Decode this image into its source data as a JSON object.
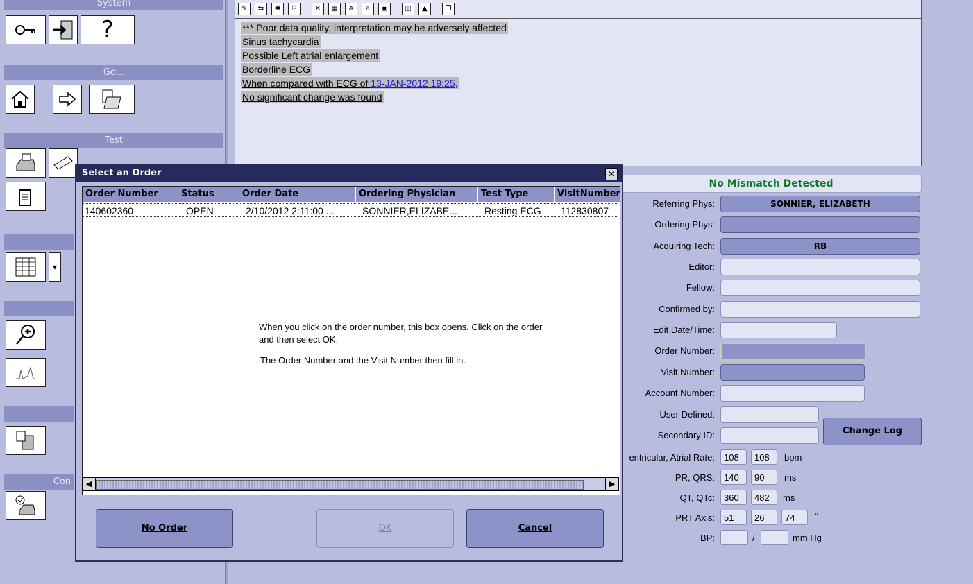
{
  "left": {
    "sections": {
      "system": "System",
      "go": "Go...",
      "test": "Test",
      "con": "Con"
    }
  },
  "ecg": {
    "lines": [
      "*** Poor data quality, interpretation may be adversely affected",
      "Sinus tachycardia",
      "Possible Left atrial enlargement",
      "Borderline ECG"
    ],
    "compare_prefix": "When compared with ECG of ",
    "compare_link": "13-JAN-2012 19:25,",
    "no_change": "No significant change was found"
  },
  "form": {
    "mismatch": "No Mismatch Detected",
    "labels": {
      "referring": "Referring Phys:",
      "ordering": "Ordering Phys:",
      "acquiring": "Acquiring Tech:",
      "editor": "Editor:",
      "fellow": "Fellow:",
      "confirmed": "Confirmed by:",
      "edit_date": "Edit Date/Time:",
      "order_number": "Order Number:",
      "visit_number": "Visit Number:",
      "account_number": "Account Number:",
      "user_defined": "User Defined:",
      "secondary_id": "Secondary ID:",
      "rate": "entricular, Atrial Rate:",
      "pr_qrs": "PR, QRS:",
      "qt_qtc": "QT, QTc:",
      "prt_axis": "PRT Axis:",
      "bp": "BP:"
    },
    "values": {
      "referring": "SONNIER, ELIZABETH",
      "acquiring": "RB",
      "vent_rate": "108",
      "atrial_rate": "108",
      "pr": "140",
      "qrs": "90",
      "qt": "360",
      "qtc": "482",
      "p_axis": "51",
      "r_axis": "26",
      "t_axis": "74"
    },
    "units": {
      "bpm": "bpm",
      "ms1": "ms",
      "ms2": "ms",
      "deg": "°",
      "slash": "/",
      "mmhg": "mm Hg"
    },
    "change_log": "Change Log"
  },
  "dialog": {
    "title": "Select an Order",
    "close": "✕",
    "columns": [
      "Order Number",
      "Status",
      "Order Date",
      "Ordering Physician",
      "Test Type",
      "VisitNumber"
    ],
    "row": [
      "140602360",
      "OPEN",
      "2/10/2012 2:11:00 ...",
      "SONNIER,ELIZABE...",
      "Resting ECG",
      "112830807"
    ],
    "note_1": "When you click on the order number, this box opens.  Click on the order and then select OK.",
    "note_2": "The Order Number and the Visit Number then fill in.",
    "buttons": {
      "no_order": "No Order",
      "ok": "OK",
      "cancel": "Cancel"
    }
  }
}
